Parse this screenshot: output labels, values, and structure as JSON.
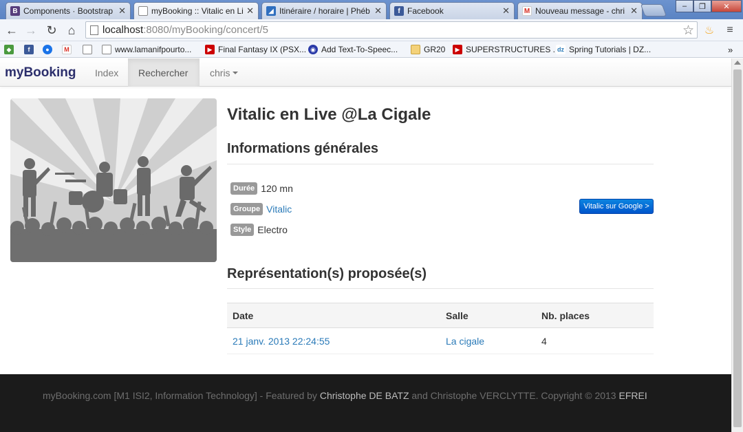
{
  "browser": {
    "tabs": [
      {
        "title": "Components · Bootstrap",
        "icon": "bootstrap-icon",
        "color": "#563d7c",
        "active": false
      },
      {
        "title": "myBooking :: Vitalic en Live",
        "icon": "document-icon",
        "color": "#ffffff",
        "active": true
      },
      {
        "title": "Itinéraire / horaire | Phéb",
        "icon": "map-icon",
        "color": "#2f6fbf",
        "active": false
      },
      {
        "title": "Facebook",
        "icon": "facebook-icon",
        "color": "#3b5998",
        "active": false
      },
      {
        "title": "Nouveau message - chri",
        "icon": "gmail-icon",
        "color": "#d93025",
        "active": false
      }
    ],
    "url_host": "localhost",
    "url_path": ":8080/myBooking/concert/5",
    "bookmarks": [
      {
        "label": "",
        "icon": "extension-icon"
      },
      {
        "label": "",
        "icon": "facebook-icon"
      },
      {
        "label": "",
        "icon": "globe-icon"
      },
      {
        "label": "",
        "icon": "gmail-icon"
      },
      {
        "label": "",
        "icon": "document-icon"
      },
      {
        "label": "www.lamanifpourto...",
        "icon": "document-icon"
      },
      {
        "label": "Final Fantasy IX (PSX...",
        "icon": "youtube-icon"
      },
      {
        "label": "Add Text-To-Speec...",
        "icon": "speech-icon"
      },
      {
        "label": "GR20",
        "icon": "folder-icon"
      },
      {
        "label": "SUPERSTRUCTURES ...",
        "icon": "youtube-icon"
      },
      {
        "label": "Spring Tutorials | DZ...",
        "icon": "dzone-icon"
      }
    ]
  },
  "nav": {
    "brand": "myBooking",
    "index": "Index",
    "search": "Rechercher",
    "user": "chris"
  },
  "concert": {
    "title": "Vitalic en Live @La Cigale",
    "general_heading": "Informations générales",
    "duration_label": "Durée",
    "duration_value": "120 mn",
    "group_label": "Groupe",
    "group_value": "Vitalic",
    "style_label": "Style",
    "style_value": "Electro",
    "google_button": "Vitalic sur Google >",
    "representations_heading": "Représentation(s) proposée(s)"
  },
  "table": {
    "headers": [
      "Date",
      "Salle",
      "Nb. places"
    ],
    "rows": [
      {
        "date": "21 janv. 2013 22:24:55",
        "salle": "La cigale",
        "places": "4"
      }
    ]
  },
  "footer": {
    "prefix": "myBooking.com [M1 ISI2, Information Technology] - Featured by ",
    "author1": "Christophe DE BATZ",
    "mid": " and Christophe VERCLYTTE. Copyright © 2013 ",
    "org": "EFREI"
  }
}
